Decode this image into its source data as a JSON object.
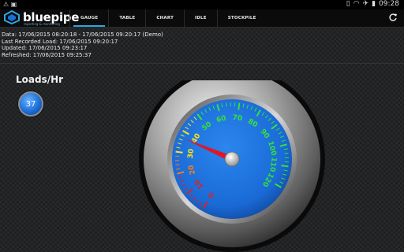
{
  "status_bar": {
    "time": "09:28"
  },
  "app": {
    "brand": "bluepipe",
    "tagline": "reporting & monitoring"
  },
  "tabs": [
    {
      "label": "GAUGE",
      "active": true
    },
    {
      "label": "TABLE",
      "active": false
    },
    {
      "label": "CHART",
      "active": false
    },
    {
      "label": "IDLE",
      "active": false
    },
    {
      "label": "STOCKPILE",
      "active": false
    }
  ],
  "info": {
    "data": "Data: 17/06/2015 08:20:18 - 17/06/2015 09:20:17 (Demo)",
    "last_recorded": "Last Recorded Load: 17/06/2015 09:20:17",
    "updated": "Updated: 17/06/2015 09:23:17",
    "refreshed": "Refreshed: 17/06/2015 09:25:37"
  },
  "metric": {
    "title": "Loads/Hr",
    "value": "37",
    "value_num": 37
  },
  "gauge": {
    "min": 0,
    "max": 120,
    "ticks": [
      "0",
      "10",
      "20",
      "30",
      "40",
      "50",
      "60",
      "70",
      "80",
      "90",
      "100",
      "110",
      "120"
    ],
    "tick_colors": [
      "#e02020",
      "#e02020",
      "#ff7a1a",
      "#ffe21a",
      "#ffe21a",
      "#35e03a",
      "#35e03a",
      "#35e03a",
      "#35e03a",
      "#35e03a",
      "#35e03a",
      "#35e03a",
      "#35e03a"
    ],
    "needle_color": "#e0162b",
    "face_color": "#1a6ad6"
  },
  "colors": {
    "accent": "#29a7df",
    "badge": "#1c6fd8"
  },
  "icons": {
    "refresh": "refresh-icon",
    "wifi": "wifi-icon",
    "airplane": "airplane-icon",
    "battery": "battery-icon"
  }
}
